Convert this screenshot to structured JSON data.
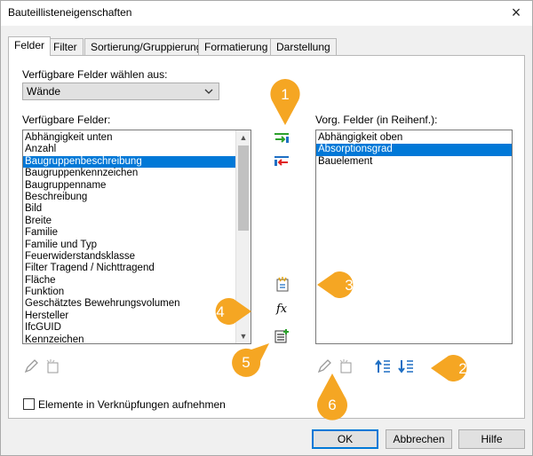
{
  "window": {
    "title": "Bauteillisteneigenschaften",
    "close_label": "×"
  },
  "tabs": [
    {
      "label": "Felder"
    },
    {
      "label": "Filter"
    },
    {
      "label": "Sortierung/Gruppierung"
    },
    {
      "label": "Formatierung"
    },
    {
      "label": "Darstellung"
    }
  ],
  "fields_tab": {
    "select_from_label": "Verfügbare Felder wählen aus:",
    "category_value": "Wände",
    "available_label": "Verfügbare Felder:",
    "available_items": [
      "Abhängigkeit unten",
      "Anzahl",
      "Baugruppenbeschreibung",
      "Baugruppenkennzeichen",
      "Baugruppenname",
      "Beschreibung",
      "Bild",
      "Breite",
      "Familie",
      "Familie und Typ",
      "Feuerwiderstandsklasse",
      "Filter Tragend / Nichttragend",
      "Fläche",
      "Funktion",
      "Geschätztes Bewehrungsvolumen",
      "Hersteller",
      "IfcGUID",
      "Kennzeichen"
    ],
    "available_selected_index": 2,
    "scheduled_label": "Vorg. Felder (in Reihenf.):",
    "scheduled_items": [
      "Abhängigkeit oben",
      "Absorptionsgrad",
      "Bauelement"
    ],
    "scheduled_selected_index": 1,
    "include_linked_label": "Elemente in Verknüpfungen aufnehmen",
    "formula_glyph": "fx"
  },
  "buttons": {
    "ok": "OK",
    "cancel": "Abbrechen",
    "help": "Hilfe"
  },
  "callouts": [
    "1",
    "2",
    "3",
    "4",
    "5",
    "6"
  ],
  "colors": {
    "accent": "#0078d7",
    "callout": "#f5a623",
    "add_arrow": "#2ca02c",
    "remove_arrow": "#e02020"
  }
}
